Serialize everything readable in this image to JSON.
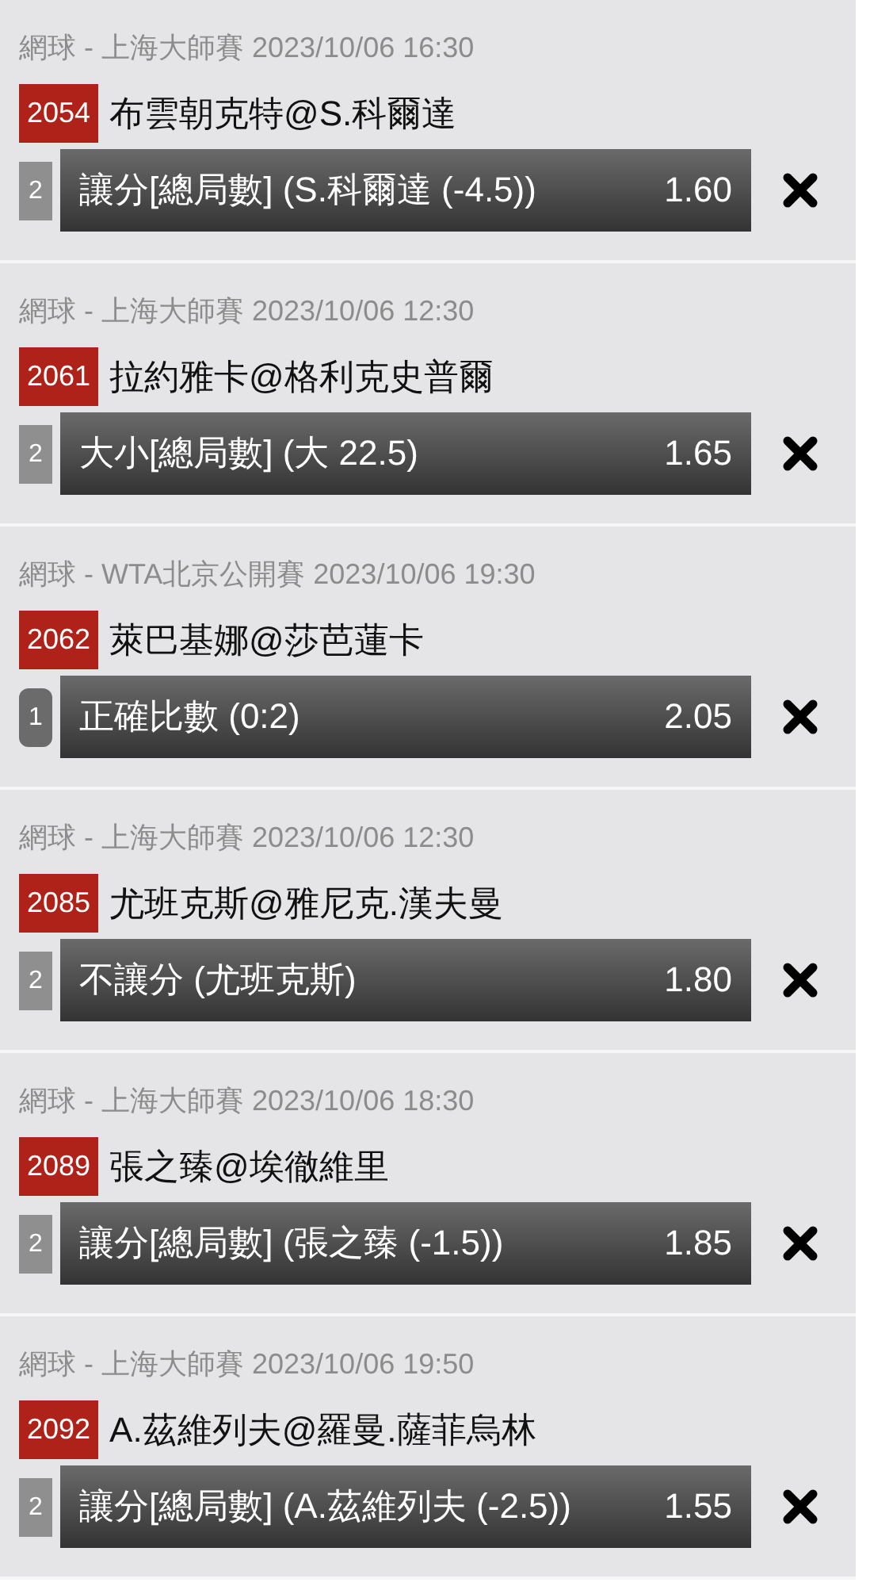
{
  "bets": [
    {
      "header": "網球 - 上海大師賽 2023/10/06 16:30",
      "code": "2054",
      "match": "布雲朝克特@S.科爾達",
      "count": "2",
      "count_highlighted": false,
      "selection": "讓分[總局數] (S.科爾達 (-4.5))",
      "odds": "1.60"
    },
    {
      "header": "網球 - 上海大師賽 2023/10/06 12:30",
      "code": "2061",
      "match": "拉約雅卡@格利克史普爾",
      "count": "2",
      "count_highlighted": false,
      "selection": "大小[總局數] (大 22.5)",
      "odds": "1.65"
    },
    {
      "header": "網球 - WTA北京公開賽 2023/10/06 19:30",
      "code": "2062",
      "match": "萊巴基娜@莎芭蓮卡",
      "count": "1",
      "count_highlighted": true,
      "selection": "正確比數 (0:2)",
      "odds": "2.05"
    },
    {
      "header": "網球 - 上海大師賽 2023/10/06 12:30",
      "code": "2085",
      "match": "尤班克斯@雅尼克.漢夫曼",
      "count": "2",
      "count_highlighted": false,
      "selection": "不讓分 (尤班克斯)",
      "odds": "1.80"
    },
    {
      "header": "網球 - 上海大師賽 2023/10/06 18:30",
      "code": "2089",
      "match": "張之臻@埃徹維里",
      "count": "2",
      "count_highlighted": false,
      "selection": "讓分[總局數] (張之臻 (-1.5))",
      "odds": "1.85"
    },
    {
      "header": "網球 - 上海大師賽 2023/10/06 19:50",
      "code": "2092",
      "match": "A.茲維列夫@羅曼.薩菲烏林",
      "count": "2",
      "count_highlighted": false,
      "selection": "讓分[總局數] (A.茲維列夫 (-2.5))",
      "odds": "1.55"
    }
  ]
}
